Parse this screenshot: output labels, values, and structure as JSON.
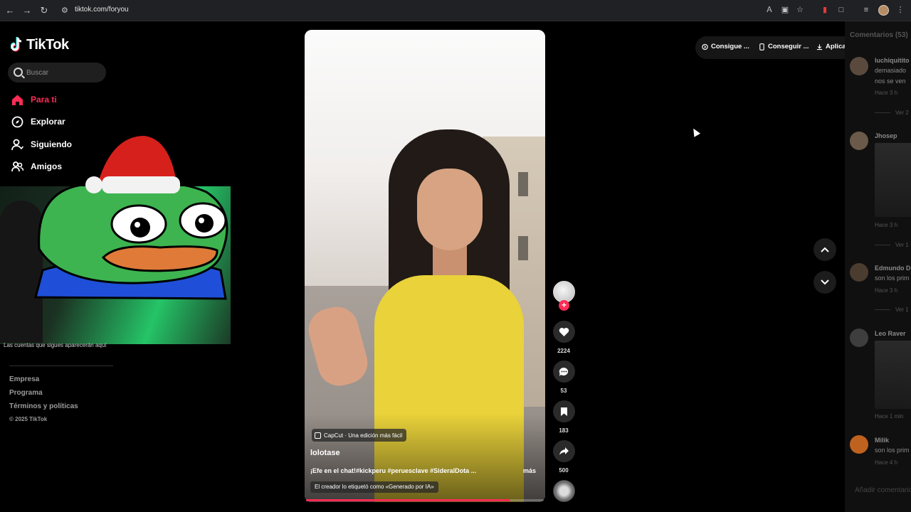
{
  "browser": {
    "url": "tiktok.com/foryou"
  },
  "logo": {
    "text": "TikTok"
  },
  "search": {
    "placeholder": "Buscar"
  },
  "nav": {
    "items": [
      {
        "label": "Para ti",
        "icon": "home-icon",
        "active": true
      },
      {
        "label": "Explorar",
        "icon": "compass-icon",
        "active": false
      },
      {
        "label": "Siguiendo",
        "icon": "user-following-icon",
        "active": false
      },
      {
        "label": "Amigos",
        "icon": "friends-icon",
        "active": false
      }
    ]
  },
  "sidebar_note": "Las cuentas que sigues aparecerán aquí",
  "footer": {
    "links": [
      "Empresa",
      "Programa",
      "Términos y políticas"
    ],
    "copyright": "© 2025 TikTok"
  },
  "video": {
    "capcut_label": "CapCut · Una edición más fácil",
    "author": "lolotase",
    "caption": "¡Efe en el chat!#kickperu #peruesclave #SideralDota ...",
    "more_label": "más",
    "ai_label": "El creador lo etiquetó como «Generado por IA»",
    "progress": 0.86
  },
  "actions": {
    "likes": "2224",
    "comments": "53",
    "saves": "183",
    "shares": "500"
  },
  "top_actions": {
    "coins": "Consigue ...",
    "device": "Conseguir ...",
    "app": "Aplicación ..."
  },
  "comments_panel": {
    "header": "Comentarios (53)",
    "items": [
      {
        "name": "luchiquitito",
        "text": [
          "demasiado",
          "nos se ven"
        ],
        "time": "Hace 3 h",
        "reply": "Ver 2"
      },
      {
        "name": "Jhosep",
        "text": [],
        "time": "Hace 3 h",
        "reply": "Ver 1"
      },
      {
        "name": "Edmundo D",
        "text": [
          "son los prim"
        ],
        "time": "Hace 3 h",
        "reply": "Ver 1"
      },
      {
        "name": "Leo Raver",
        "text": [],
        "time": "Hace 1 min",
        "reply": ""
      },
      {
        "name": "Milik",
        "text": [
          "son los prim"
        ],
        "time": "Hace 4 h",
        "reply": ""
      }
    ],
    "input_placeholder": "Añadir comentario..."
  },
  "colors": {
    "accent": "#fe2c55",
    "background": "#000000",
    "panel": "#101010"
  }
}
